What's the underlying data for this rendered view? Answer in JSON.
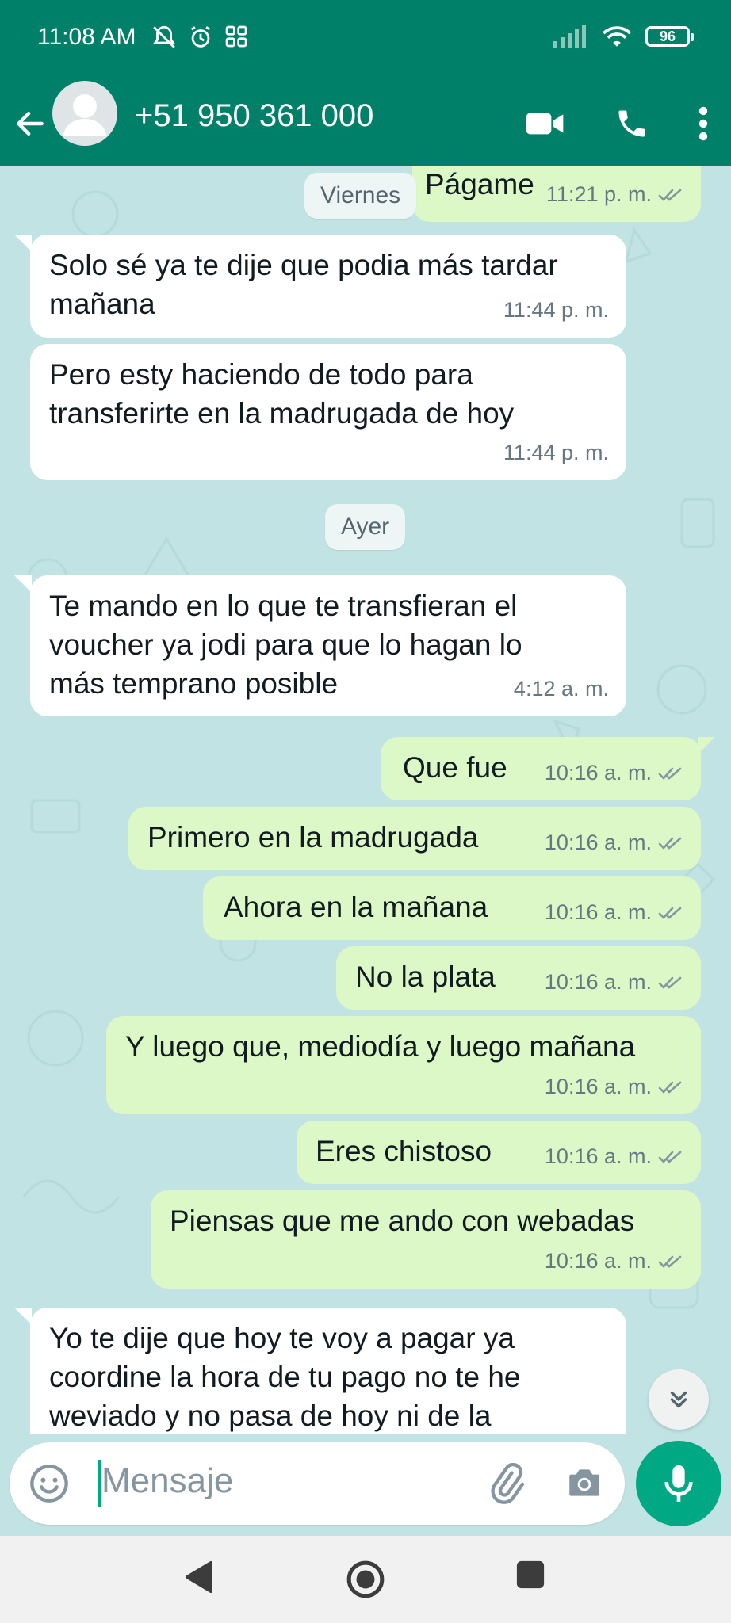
{
  "status_bar": {
    "time": "11:08 AM",
    "battery": "96"
  },
  "header": {
    "contact_name": "+51 950 361 000"
  },
  "chat": {
    "partial_top": {
      "text": "Págame",
      "time": "11:21 p. m."
    },
    "day_labels": {
      "friday": "Viernes",
      "yesterday": "Ayer"
    },
    "messages": [
      {
        "dir": "in",
        "text": "Solo sé ya te dije que podia más tardar mañana",
        "time": "11:44 p. m."
      },
      {
        "dir": "in",
        "text": "Pero esty haciendo de todo para transferirte en la madrugada de hoy",
        "time": "11:44 p. m."
      },
      {
        "dir": "in",
        "text": "Te mando en lo que te transfieran el voucher ya jodi para que lo hagan lo más temprano posible",
        "time": "4:12 a. m."
      },
      {
        "dir": "out",
        "text": "Que fue",
        "time": "10:16 a. m."
      },
      {
        "dir": "out",
        "text": "Primero en la madrugada",
        "time": "10:16 a. m."
      },
      {
        "dir": "out",
        "text": "Ahora en la mañana",
        "time": "10:16 a. m."
      },
      {
        "dir": "out",
        "text": "No la plata",
        "time": "10:16 a. m."
      },
      {
        "dir": "out",
        "text": "Y luego que, mediodía y luego mañana",
        "time": "10:16 a. m."
      },
      {
        "dir": "out",
        "text": "Eres chistoso",
        "time": "10:16 a. m."
      },
      {
        "dir": "out",
        "text": "Piensas que me ando con webadas",
        "time": "10:16 a. m."
      },
      {
        "dir": "in",
        "text": "Yo te dije que hoy te voy a pagar ya coordine la hora de tu pago no te he weviado y no pasa de hoy ni de la",
        "time": ""
      }
    ]
  },
  "composer": {
    "placeholder": "Mensaje"
  },
  "colors": {
    "header": "#008069",
    "outgoing": "#dcf8c6",
    "incoming": "#ffffff",
    "accent": "#00a884",
    "read_ticks": "#8696a0"
  },
  "icons": {
    "back": "arrow-left-icon",
    "video": "video-call-icon",
    "phone": "phone-icon",
    "menu": "more-vert-icon",
    "emoji": "emoji-icon",
    "attach": "paperclip-icon",
    "camera": "camera-icon",
    "mic": "mic-icon",
    "scroll": "double-chevron-down-icon"
  }
}
